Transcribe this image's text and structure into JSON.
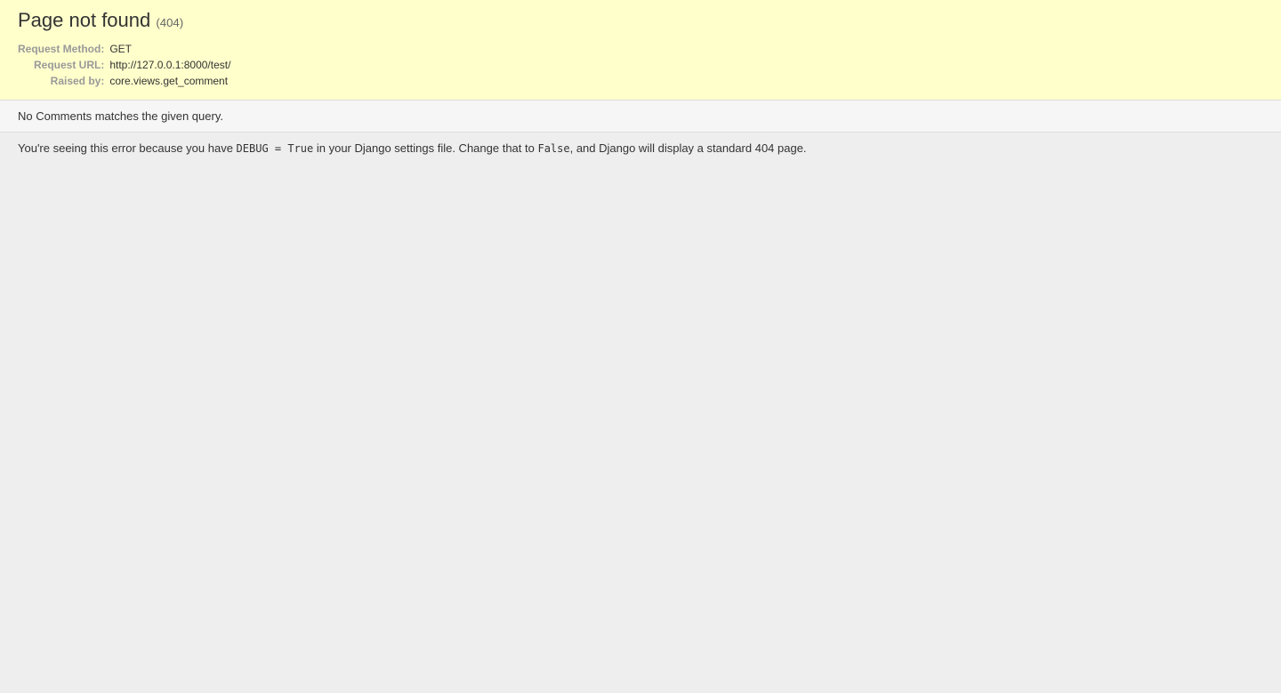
{
  "header": {
    "title": "Page not found ",
    "status_code": "(404)",
    "meta": {
      "request_method_label": "Request Method:",
      "request_method_value": "GET",
      "request_url_label": "Request URL:",
      "request_url_value": "http://127.0.0.1:8000/test/",
      "raised_by_label": "Raised by:",
      "raised_by_value": "core.views.get_comment"
    }
  },
  "info": {
    "message": "No Comments matches the given query."
  },
  "explanation": {
    "prefix": "You're seeing this error because you have ",
    "code1": "DEBUG = True",
    "middle": " in your Django settings file. Change that to ",
    "code2": "False",
    "suffix": ", and Django will display a standard 404 page."
  }
}
